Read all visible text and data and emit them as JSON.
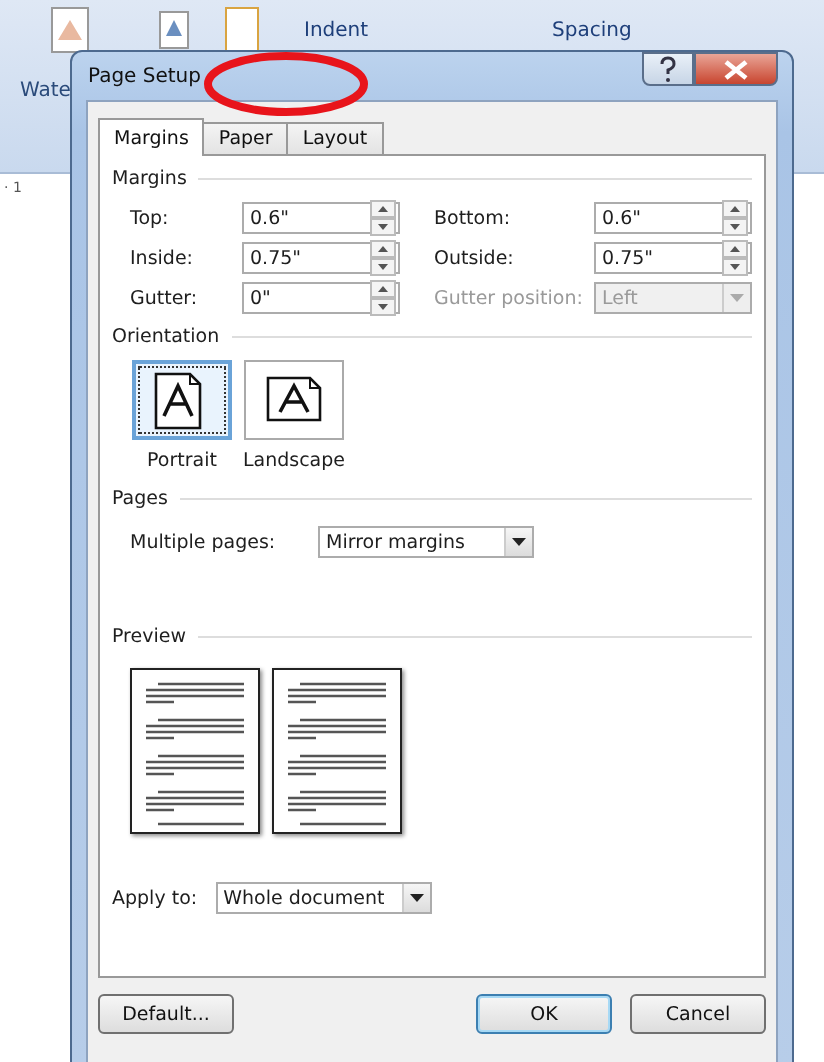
{
  "background": {
    "ribbon_labels": [
      "Wate",
      "Indent",
      "Spacing"
    ],
    "ruler_mark": "· 1"
  },
  "window": {
    "title": "Page Setup"
  },
  "tabs": [
    {
      "label": "Margins",
      "selected": true
    },
    {
      "label": "Paper",
      "selected": false
    },
    {
      "label": "Layout",
      "selected": false
    }
  ],
  "annotation": {
    "kind": "ellipse",
    "color": "#e8141b"
  },
  "margins": {
    "heading": "Margins",
    "fields": [
      {
        "label": "Top:",
        "value": "0.6\"",
        "kind": "spin",
        "disabled": false
      },
      {
        "label": "Bottom:",
        "value": "0.6\"",
        "kind": "spin",
        "disabled": false
      },
      {
        "label": "Inside:",
        "value": "0.75\"",
        "kind": "spin",
        "disabled": false
      },
      {
        "label": "Outside:",
        "value": "0.75\"",
        "kind": "spin",
        "disabled": false
      },
      {
        "label": "Gutter:",
        "value": "0\"",
        "kind": "spin",
        "disabled": false
      },
      {
        "label": "Gutter position:",
        "value": "Left",
        "kind": "combo",
        "disabled": true
      }
    ]
  },
  "orientation": {
    "heading": "Orientation",
    "options": [
      {
        "label": "Portrait",
        "kind": "portrait",
        "selected": true
      },
      {
        "label": "Landscape",
        "kind": "landscape",
        "selected": false
      }
    ]
  },
  "pages": {
    "heading": "Pages",
    "multiple_pages": {
      "label": "Multiple pages:",
      "value": "Mirror margins"
    }
  },
  "preview": {
    "heading": "Preview"
  },
  "apply_to": {
    "label": "Apply to:",
    "value": "Whole document"
  },
  "buttons": [
    {
      "label": "Default...",
      "default": false
    },
    {
      "label": "OK",
      "default": true
    },
    {
      "label": "Cancel",
      "default": false
    }
  ]
}
